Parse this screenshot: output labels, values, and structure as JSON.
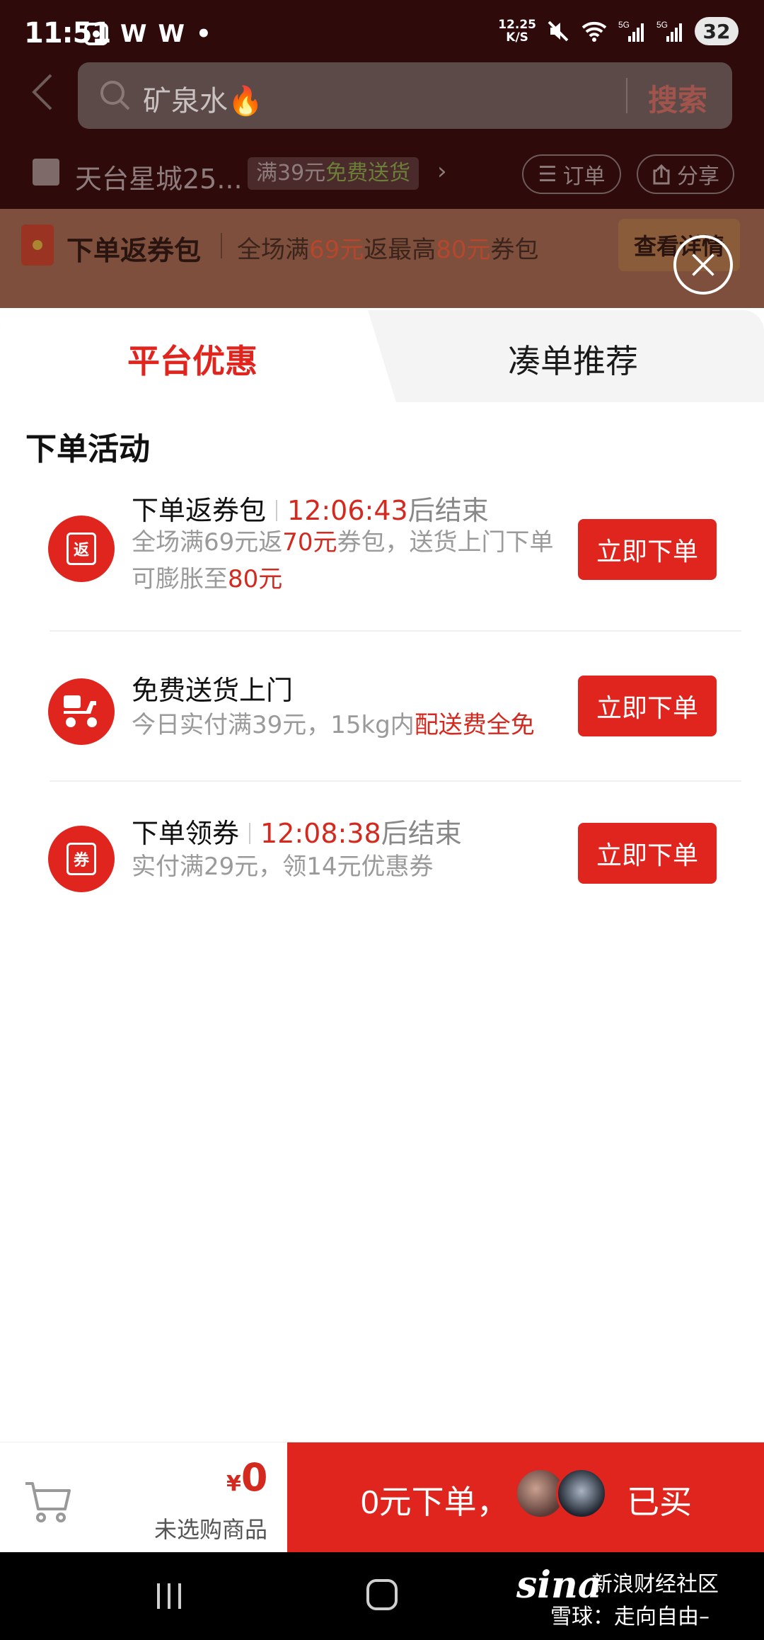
{
  "status_bar": {
    "time": "11:51",
    "left_icons": [
      "W",
      "W",
      "•"
    ],
    "net_speed_value": "12.25",
    "net_speed_unit": "K/S",
    "battery": "32"
  },
  "search": {
    "query": "矿泉水🔥",
    "button_label": "搜索"
  },
  "store": {
    "name": "天台星城25...",
    "free_delivery_prefix": "满39元",
    "free_delivery_highlight": "免费送货",
    "orders_label": "订单",
    "share_label": "分享"
  },
  "promo_banner": {
    "title": "下单返券包",
    "desc_1": "全场满",
    "desc_2": "69元",
    "desc_3": "返最高",
    "desc_4": "80元",
    "desc_5": "券包",
    "view_label": "查看详情"
  },
  "tabs": {
    "platform": "平台优惠",
    "bundle": "凑单推荐"
  },
  "section_title": "下单活动",
  "activities": [
    {
      "icon": "return-coupon-icon",
      "icon_text": "返",
      "name": "下单返券包",
      "time": "12:06:43",
      "end_suffix": "后结束",
      "desc_1": "全场满69元返",
      "desc_2": "70元",
      "desc_3": "券包，送货上门下单可膨胀至",
      "desc_4": "80元",
      "button": "立即下单"
    },
    {
      "icon": "delivery-scooter-icon",
      "name": "免费送货上门",
      "desc_1": "今日实付满39元，15kg内",
      "desc_2": "配送费全免",
      "button": "立即下单"
    },
    {
      "icon": "coupon-icon",
      "icon_text": "券",
      "name": "下单领券",
      "time": "12:08:38",
      "end_suffix": "后结束",
      "desc_1": "实付满29元，领14元优惠券",
      "button": "立即下单"
    }
  ],
  "cart": {
    "currency": "¥",
    "amount": "0",
    "hint": "未选购商品",
    "order_text": "0元下单，",
    "bought_text": "已买"
  },
  "watermark": {
    "logo": "sina",
    "line1": "新浪财经社区",
    "line2": "雪球：走向自由–"
  },
  "colors": {
    "accent": "#e0251f",
    "highlight_red": "#d4291f",
    "dim_background": "#2e0a0b"
  }
}
